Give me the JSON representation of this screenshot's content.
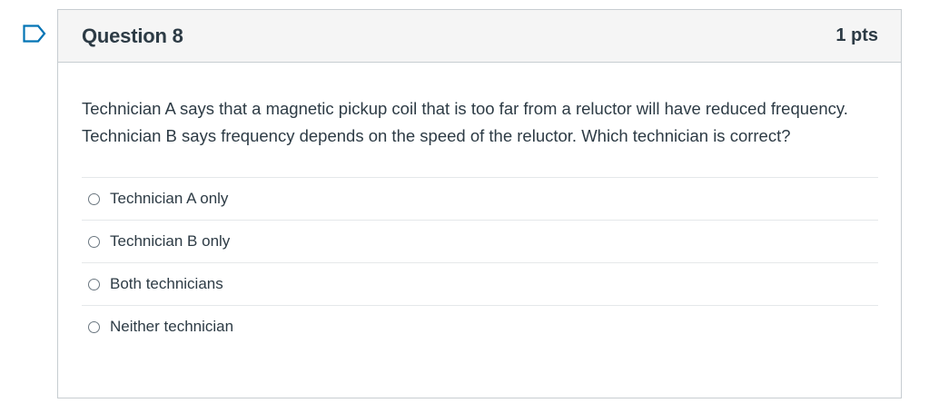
{
  "flag": {
    "icon": "flag-icon",
    "color": "#0374b5"
  },
  "question": {
    "title": "Question 8",
    "points": "1 pts",
    "text": "Technician A says that a magnetic pickup coil that is too far from a reluctor will have reduced frequency. Technician B says frequency depends on the speed of the reluctor. Which technician is correct?",
    "answers": [
      {
        "label": "Technician A only",
        "selected": false
      },
      {
        "label": "Technician B only",
        "selected": false
      },
      {
        "label": "Both technicians",
        "selected": false
      },
      {
        "label": "Neither technician",
        "selected": false
      }
    ]
  },
  "colors": {
    "header_bg": "#f5f5f5",
    "border": "#c7cdd1",
    "text": "#2d3b45"
  }
}
